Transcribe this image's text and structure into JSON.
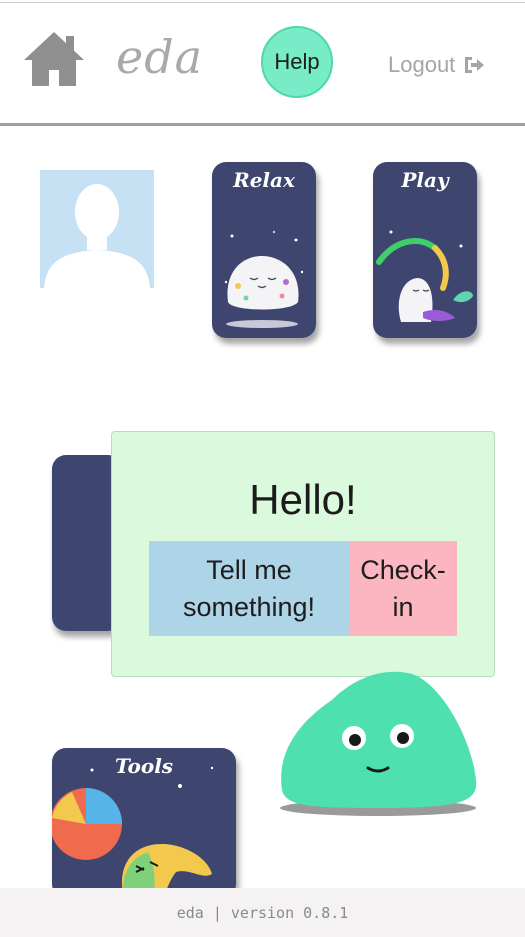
{
  "header": {
    "logo_text": "eda",
    "help_label": "Help",
    "logout_label": "Logout",
    "icons": {
      "home": "home-icon",
      "logout": "logout-icon"
    }
  },
  "profile": {
    "avatar_icon": "avatar-icon"
  },
  "activities": [
    {
      "title": "Relax"
    },
    {
      "title": "Play"
    },
    {
      "title": "Tools"
    }
  ],
  "greeting": {
    "title": "Hello!",
    "tell_label": "Tell me\nsomething!",
    "checkin_label": "Check-\nin"
  },
  "footer": {
    "text": "eda  |  version 0.8.1"
  },
  "colors": {
    "accent": "#78ecc6",
    "card": "#3e4670",
    "panel": "#dbf9dc",
    "tell": "#aed4e8",
    "checkin": "#fbb6c1",
    "blob": "#4fe0b0"
  }
}
